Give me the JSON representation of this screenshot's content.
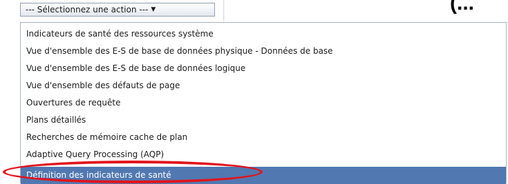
{
  "toolbar": {
    "action_select_label": "--- Sélectionnez une action ---",
    "corner_text": "(..."
  },
  "menu": {
    "items": [
      {
        "label": "Indicateurs de santé des ressources système"
      },
      {
        "label": "Vue d'ensemble des E-S de base de données physique - Données de base"
      },
      {
        "label": "Vue d'ensemble des E-S de base de données logique"
      },
      {
        "label": "Vue d'ensemble des défauts de page"
      },
      {
        "label": "Ouvertures de requête"
      },
      {
        "label": "Plans détaillés"
      },
      {
        "label": "Recherches de mémoire cache de plan"
      },
      {
        "label": "Adaptive Query Processing (AQP)"
      },
      {
        "label": "Définition des indicateurs de santé",
        "selected": true
      }
    ]
  },
  "colors": {
    "selected_row": "#5178b1",
    "annotation_ring": "#e1141c",
    "menu_border": "#a7b3c3"
  },
  "icons": {
    "dropdown_arrow": "triangle-down-icon"
  }
}
